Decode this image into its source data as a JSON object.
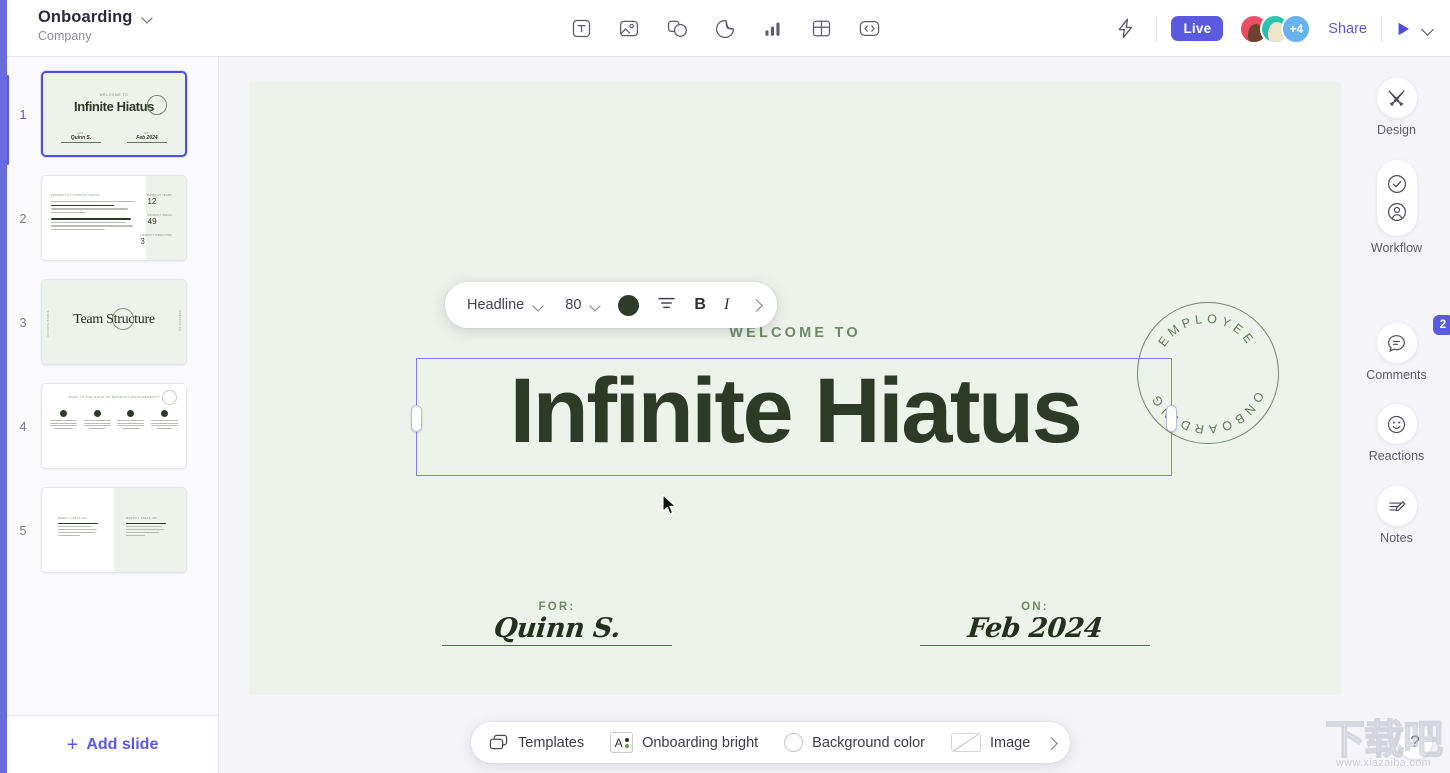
{
  "topbar": {
    "doc_title": "Onboarding",
    "doc_subtitle": "Company",
    "tools": [
      {
        "name": "text-tool",
        "label": "Text"
      },
      {
        "name": "image-tool",
        "label": "Image"
      },
      {
        "name": "shapes-tool",
        "label": "Shapes"
      },
      {
        "name": "sticker-tool",
        "label": "Sticker"
      },
      {
        "name": "chart-tool",
        "label": "Chart"
      },
      {
        "name": "table-tool",
        "label": "Table"
      },
      {
        "name": "embed-tool",
        "label": "Embed"
      }
    ],
    "bolt_label": "Shortcuts",
    "live_label": "Live",
    "avatar_overflow": "+4",
    "share_label": "Share",
    "present_label": "Present"
  },
  "slides_panel": {
    "add_slide_label": "Add slide",
    "add_slide_plus": "+",
    "slides": [
      {
        "number": "1",
        "active": true,
        "kind": "title",
        "eyebrow": "WELCOME TO",
        "headline": "Infinite Hiatus",
        "for_label": "FOR:",
        "for_value": "Quinn S.",
        "on_label": "ON:",
        "on_value": "Feb 2024"
      },
      {
        "number": "2",
        "active": false,
        "kind": "stats",
        "eyebrow": "PRODUCT AT INFINITE HIATUS",
        "stats": [
          {
            "label": "PRODUCT TEAMS",
            "value": "12"
          },
          {
            "label": "PRODUCT AREAS",
            "value": "49"
          },
          {
            "label": "PRODUCT DIRECTORS",
            "value": "3"
          }
        ]
      },
      {
        "number": "3",
        "active": false,
        "kind": "section",
        "headline": "Team Structure",
        "side_left": "INFINITE HIATUS",
        "side_right": "ONBOARDING"
      },
      {
        "number": "4",
        "active": false,
        "kind": "columns",
        "eyebrow": "WHAT IS THE ROLE OF PRODUCT MANAGEMENT?",
        "columns": 4
      },
      {
        "number": "5",
        "active": false,
        "kind": "split",
        "left_title": "WEEKLY CHECK-INS",
        "right_title": "MONTHLY CHECK-INS"
      }
    ]
  },
  "text_toolbar": {
    "style_name": "Headline",
    "font_size": "80",
    "color": "#2f3c28",
    "align_label": "Align center",
    "bold_label": "B",
    "italic_label": "I",
    "more_label": "More options"
  },
  "slide": {
    "eyebrow": "WELCOME TO",
    "headline": "Infinite Hiatus",
    "stamp_text": "EMPLOYEE ONBOARDING",
    "stamp_top": "EMPLOYEE",
    "stamp_bottom": "ONBOARDING",
    "for_label": "FOR:",
    "for_value": "Quinn S.",
    "on_label": "ON:",
    "on_value": "Feb 2024",
    "background_color": "#edf2ea",
    "text_color": "#2c3a26",
    "accent_color": "#6d8a63"
  },
  "bottom_bar": {
    "templates_label": "Templates",
    "theme_label": "Onboarding bright",
    "background_color_label": "Background color",
    "image_label": "Image",
    "more_label": "More"
  },
  "right_bar": {
    "items": [
      {
        "name": "design",
        "label": "Design",
        "badge": null
      },
      {
        "name": "workflow",
        "label": "Workflow",
        "badge": null
      },
      {
        "name": "comments",
        "label": "Comments",
        "badge": "2"
      },
      {
        "name": "reactions",
        "label": "Reactions",
        "badge": null
      },
      {
        "name": "notes",
        "label": "Notes",
        "badge": null
      }
    ]
  },
  "help": {
    "label": "?"
  },
  "watermark": {
    "main": "下载吧",
    "sub": "www.xiazaiba.com"
  }
}
